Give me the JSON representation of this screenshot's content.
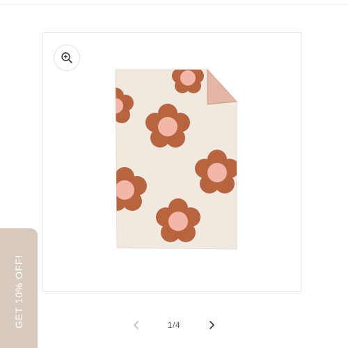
{
  "gallery": {
    "counter": "1/4",
    "product_image": {
      "description_icon": "flower-blanket-image",
      "colors": {
        "blanket": "#efe9df",
        "petal": "#b8643f",
        "center": "#f2b7a8",
        "fold_back": "#e3b6a6"
      }
    }
  },
  "icons": {
    "zoom": "zoom-in-icon",
    "prev": "chevron-left-icon",
    "next": "chevron-right-icon"
  },
  "promo": {
    "label": "GET 10% OFF!",
    "color": "#d7c9bd"
  }
}
